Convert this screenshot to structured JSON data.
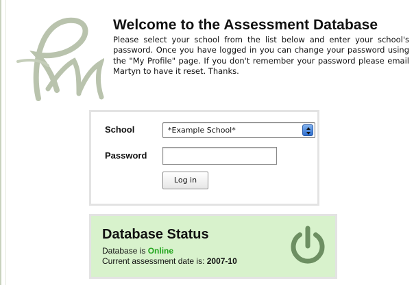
{
  "welcome": {
    "title": "Welcome to the Assessment Database",
    "text": "Please select your school from the list below and enter your school's password. Once you have logged in you can change your password using the \"My Profile\" page. If you don't remember your password please email Martyn to have it reset. Thanks."
  },
  "login": {
    "school_label": "School",
    "school_value": "*Example School*",
    "password_label": "Password",
    "password_value": "",
    "button_label": "Log in"
  },
  "status": {
    "title": "Database Status",
    "db_prefix": "Database is ",
    "db_state": "Online",
    "date_prefix": "Current assessment date is: ",
    "date_value": "2007-10"
  },
  "colors": {
    "online": "#22a51d",
    "status_bg": "#d8f2cc",
    "power_icon": "#6d8f62",
    "logo": "#b9c3ad"
  },
  "icons": {
    "logo": "rm-monogram-logo",
    "select": "select-arrows-icon",
    "status": "power-icon"
  }
}
